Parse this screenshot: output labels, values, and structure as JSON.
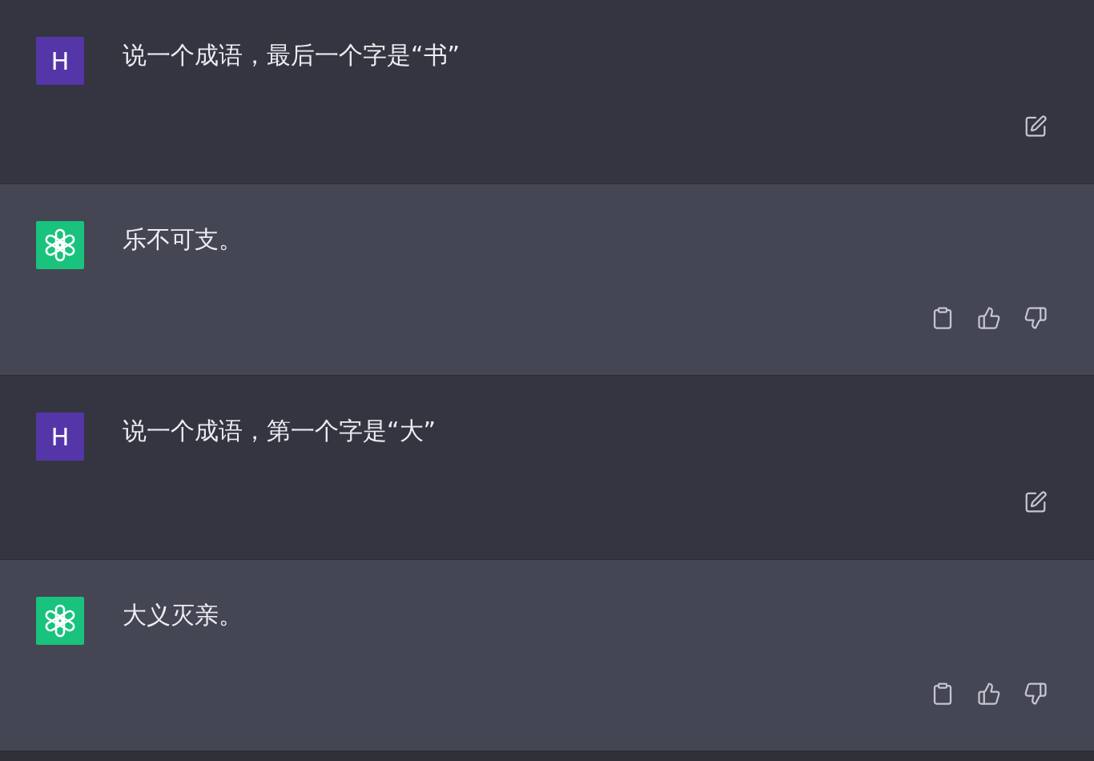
{
  "messages": [
    {
      "kind": "user",
      "avatar": "H",
      "text": "说一个成语，最后一个字是“书”"
    },
    {
      "kind": "assistant",
      "text": "乐不可支。"
    },
    {
      "kind": "user",
      "avatar": "H",
      "text": "说一个成语，第一个字是“大”"
    },
    {
      "kind": "assistant",
      "text": "大义灭亲。"
    }
  ]
}
